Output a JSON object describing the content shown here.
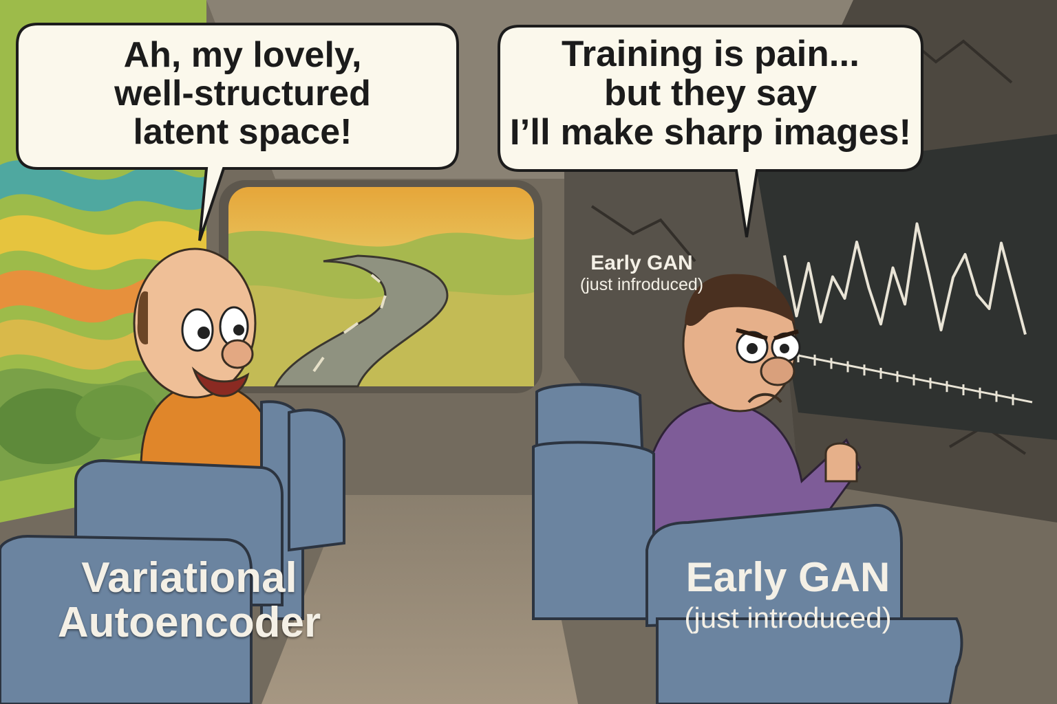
{
  "comic": {
    "left_character": {
      "speech": "Ah, my lovely,\nwell-structured\nlatent space!",
      "label": "Variational Autoencoder"
    },
    "right_character": {
      "speech": "Training is pain...\nbut they say\nI’ll make sharp images!",
      "seat_label_title": "Early GAN",
      "seat_label_subtitle": "(just introduced)",
      "head_label_title": "Early GAN",
      "head_label_subtitle": "(just infroduced)"
    }
  },
  "colors": {
    "left_shirt": "#e0862a",
    "right_shirt": "#7e5c98",
    "seat_blue": "#6b84a0",
    "bubble_fill": "#fbf8ec",
    "chalkboard": "#2f3230",
    "rock_wall": "#4a463f"
  },
  "loss_curve": {
    "description_values": [
      0.55,
      0.22,
      0.5,
      0.18,
      0.42,
      0.3,
      0.6,
      0.35,
      0.15,
      0.45,
      0.25,
      0.68,
      0.4,
      0.1,
      0.38,
      0.5,
      0.28,
      0.2,
      0.55,
      0.3,
      0.05
    ]
  }
}
